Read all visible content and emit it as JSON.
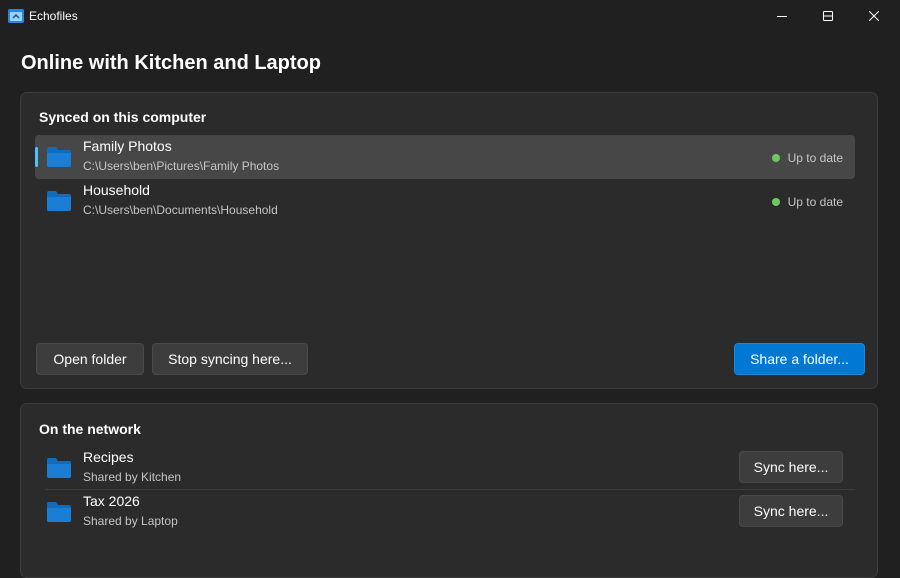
{
  "window": {
    "app_name": "Echofiles",
    "icon": "app-icon",
    "controls": [
      "minimize-icon",
      "maximize-icon",
      "close-icon"
    ]
  },
  "page": {
    "title": "Online with Kitchen and Laptop"
  },
  "synced": {
    "title": "Synced on this computer",
    "items": [
      {
        "name": "Family Photos",
        "path": "C:\\Users\\ben\\Pictures\\Family Photos",
        "status": "Up to date",
        "selected": true
      },
      {
        "name": "Household",
        "path": "C:\\Users\\ben\\Documents\\Household",
        "status": "Up to date",
        "selected": false
      }
    ],
    "open_folder_label": "Open folder",
    "stop_syncing_label": "Stop syncing here...",
    "share_folder_label": "Share a folder..."
  },
  "network": {
    "title": "On the network",
    "items": [
      {
        "name": "Recipes",
        "shared_by": "Shared by Kitchen",
        "action": "Sync here..."
      },
      {
        "name": "Tax 2026",
        "shared_by": "Shared by Laptop",
        "action": "Sync here..."
      }
    ]
  },
  "colors": {
    "background": "#202020",
    "card": "#2b2b2b",
    "accent": "#0078d4",
    "selection_accent": "#4cc2ff",
    "status_ok": "#6ccb5f",
    "folder": "#0f6cbd"
  }
}
